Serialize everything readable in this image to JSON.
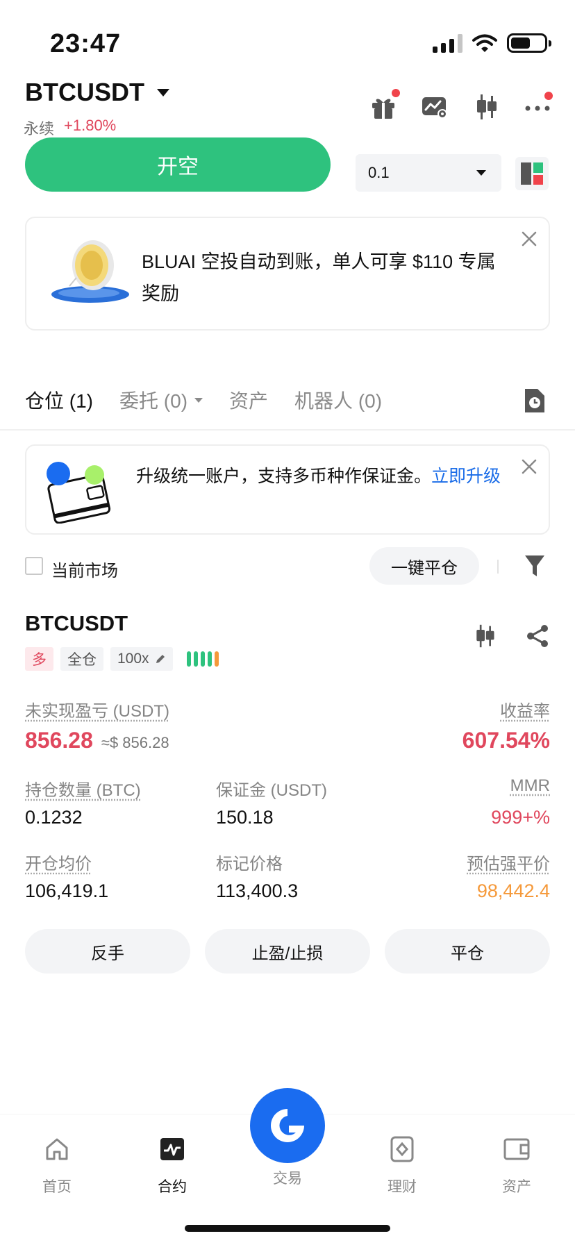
{
  "status_bar": {
    "time": "23:47"
  },
  "header": {
    "symbol": "BTCUSDT",
    "contract_type": "永续",
    "change": "+1.80%"
  },
  "order": {
    "short_button": "开空",
    "quantity": "0.1"
  },
  "promo": {
    "text": "BLUAI 空投自动到账，单人可享 $110 专属奖励"
  },
  "tabs": [
    {
      "label": "仓位 (1)"
    },
    {
      "label": "委托 (0)"
    },
    {
      "label": "资产"
    },
    {
      "label": "机器人 (0)"
    }
  ],
  "upgrade": {
    "text": "升级统一账户，支持多币种作保证金。",
    "link": "立即升级"
  },
  "filter": {
    "current_market": "当前市场",
    "close_all": "一键平仓"
  },
  "position": {
    "symbol": "BTCUSDT",
    "side": "多",
    "margin_mode": "全仓",
    "leverage": "100x",
    "unrealized_pnl_label": "未实现盈亏 (USDT)",
    "unrealized_pnl": "856.28",
    "unrealized_pnl_usd": "≈$ 856.28",
    "roi_label": "收益率",
    "roi": "607.54%",
    "size_label": "持仓数量 (BTC)",
    "size": "0.1232",
    "margin_label": "保证金 (USDT)",
    "margin": "150.18",
    "mmr_label": "MMR",
    "mmr": "999+%",
    "entry_label": "开仓均价",
    "entry": "106,419.1",
    "mark_label": "标记价格",
    "mark": "113,400.3",
    "liq_label": "预估强平价",
    "liq": "98,442.4",
    "actions": [
      "反手",
      "止盈/止损",
      "平仓"
    ]
  },
  "nav": [
    {
      "label": "首页"
    },
    {
      "label": "合约"
    },
    {
      "label": "交易"
    },
    {
      "label": "理财"
    },
    {
      "label": "资产"
    }
  ],
  "colors": {
    "green": "#2ec27e",
    "red": "#e0475d",
    "orange": "#f5993a",
    "blue": "#1a6cf0"
  }
}
